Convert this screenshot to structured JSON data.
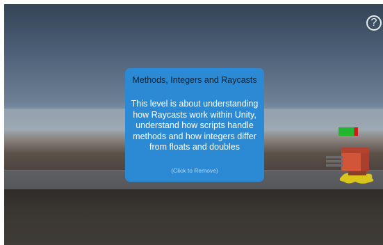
{
  "help": {
    "label": "?"
  },
  "info_panel": {
    "title": "Methods, Integers and Raycasts",
    "body": "This level is about understanding how Raycasts work within Unity, understand how scripts handle methods and how integers differ from floats and doubles",
    "hint": "(Click to Remove)"
  },
  "enemy": {
    "health_fraction": 0.8,
    "health_color": "#21b531",
    "damage_color": "#c81d1d"
  }
}
